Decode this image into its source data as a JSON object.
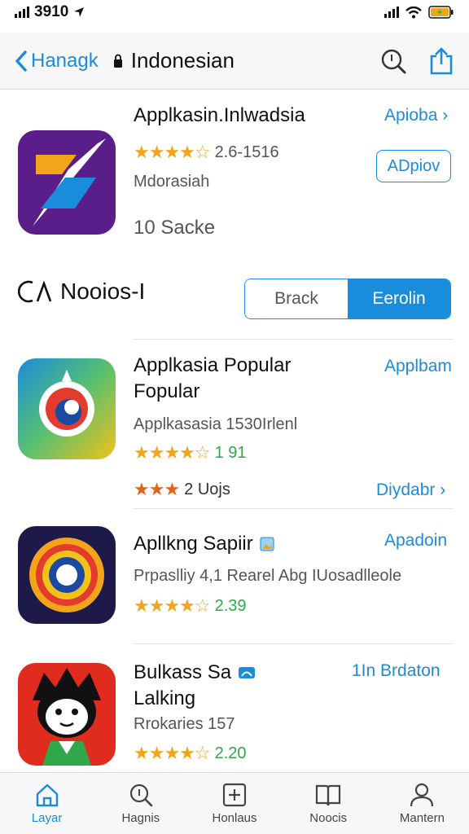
{
  "status_bar": {
    "time": "3910"
  },
  "nav": {
    "back_label": "Hanagk",
    "title": "Indonesian"
  },
  "featured": {
    "title": "Applkasin.Inlwadsia",
    "subtitle": "Mdorasiah",
    "rating_value": "2.6-1516",
    "rating_stars": 4.5,
    "size": "10 Sacke",
    "link": "Apioba",
    "button": "ADpiov"
  },
  "section": {
    "title": "Nooios-I",
    "segments": [
      "Brack",
      "Eerolin"
    ],
    "active_segment": 1
  },
  "apps": [
    {
      "title_line1": "Applkasia Popular",
      "title_line2": "Fopular",
      "meta": "Applkasasia 1530Irlenl",
      "rating_value": "1 91",
      "rating_stars": 4.5,
      "extra": "2 Uojs",
      "extra_stars": 3,
      "link": "Applbam",
      "link2": "Diydabr"
    },
    {
      "title_line1": "Apllkng Sapiir",
      "meta": "Prpaslliy 4,1 Rearel Abg IUosadlleole",
      "rating_value": "2.39",
      "rating_stars": 4.5,
      "link": "Apadoin"
    },
    {
      "title_line1": "Bulkass Sa",
      "title_line2": "Lalking",
      "meta": "Rrokaries 157",
      "rating_value": "2.20",
      "rating_stars": 4.5,
      "link": "1In Brdaton"
    }
  ],
  "tabs": [
    "Layar",
    "Hagnis",
    "Honlaus",
    "Noocis",
    "Mantern"
  ],
  "active_tab": 0,
  "colors": {
    "accent": "#1a8cdc",
    "star": "#f2a51a"
  }
}
